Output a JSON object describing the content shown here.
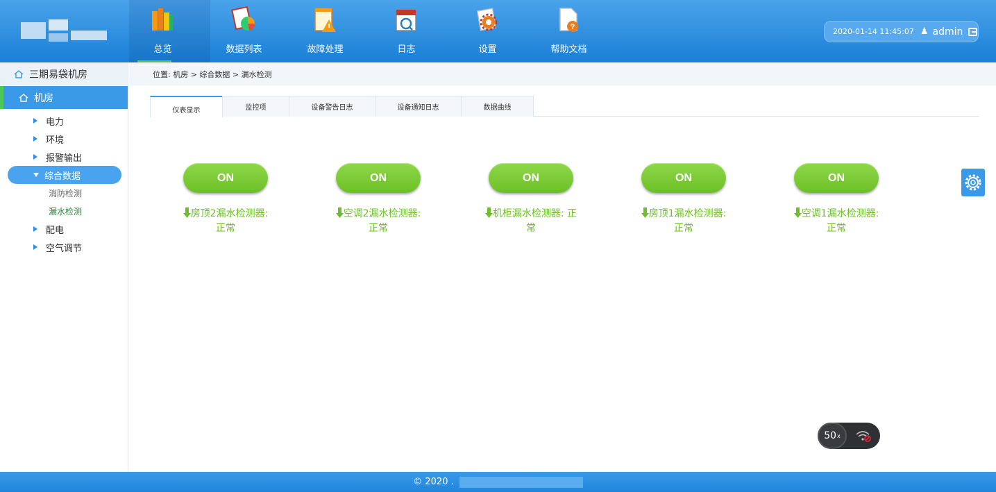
{
  "header": {
    "nav": [
      {
        "label": "总览",
        "icon": "books-icon",
        "active": true
      },
      {
        "label": "数据列表",
        "icon": "chart-document-icon",
        "active": false
      },
      {
        "label": "故障处理",
        "icon": "warning-notepad-icon",
        "active": false
      },
      {
        "label": "日志",
        "icon": "calendar-icon",
        "active": false
      },
      {
        "label": "设置",
        "icon": "gear-document-icon",
        "active": false
      },
      {
        "label": "帮助文档",
        "icon": "help-document-icon",
        "active": false
      }
    ],
    "user": {
      "datetime": "2020-01-14 11:45:07",
      "name": "admin"
    }
  },
  "sidebar": {
    "site": "三期易袋机房",
    "root": "机房",
    "items": [
      {
        "label": "电力"
      },
      {
        "label": "环境"
      },
      {
        "label": "报警输出"
      },
      {
        "label": "综合数据",
        "open": true,
        "children": [
          "消防检测",
          "漏水检测"
        ],
        "selected_child": "漏水检测"
      },
      {
        "label": "配电"
      },
      {
        "label": "空气调节"
      }
    ]
  },
  "breadcrumb": "位置:  机房 > 综合数据 > 漏水检测",
  "tabs": [
    {
      "label": "仪表显示",
      "active": true
    },
    {
      "label": "监控项"
    },
    {
      "label": "设备警告日志"
    },
    {
      "label": "设备通知日志"
    },
    {
      "label": "数据曲线"
    }
  ],
  "meters": [
    {
      "state": "ON",
      "name": "房顶2漏水检测器:",
      "status": "正常"
    },
    {
      "state": "ON",
      "name": "空调2漏水检测器:",
      "status": "正常"
    },
    {
      "state": "ON",
      "name": "机柜漏水检测器: 正",
      "status": "常"
    },
    {
      "state": "ON",
      "name": "房顶1漏水检测器:",
      "status": "正常"
    },
    {
      "state": "ON",
      "name": "空调1漏水检测器:",
      "status": "正常"
    }
  ],
  "speed_widget": {
    "value": "50",
    "unit": "x"
  },
  "footer": {
    "copyright": "© 2020 ."
  },
  "colors": {
    "primary": "#3a9ae8",
    "accent_green": "#4cc85a",
    "ok_green": "#6cbf26"
  }
}
